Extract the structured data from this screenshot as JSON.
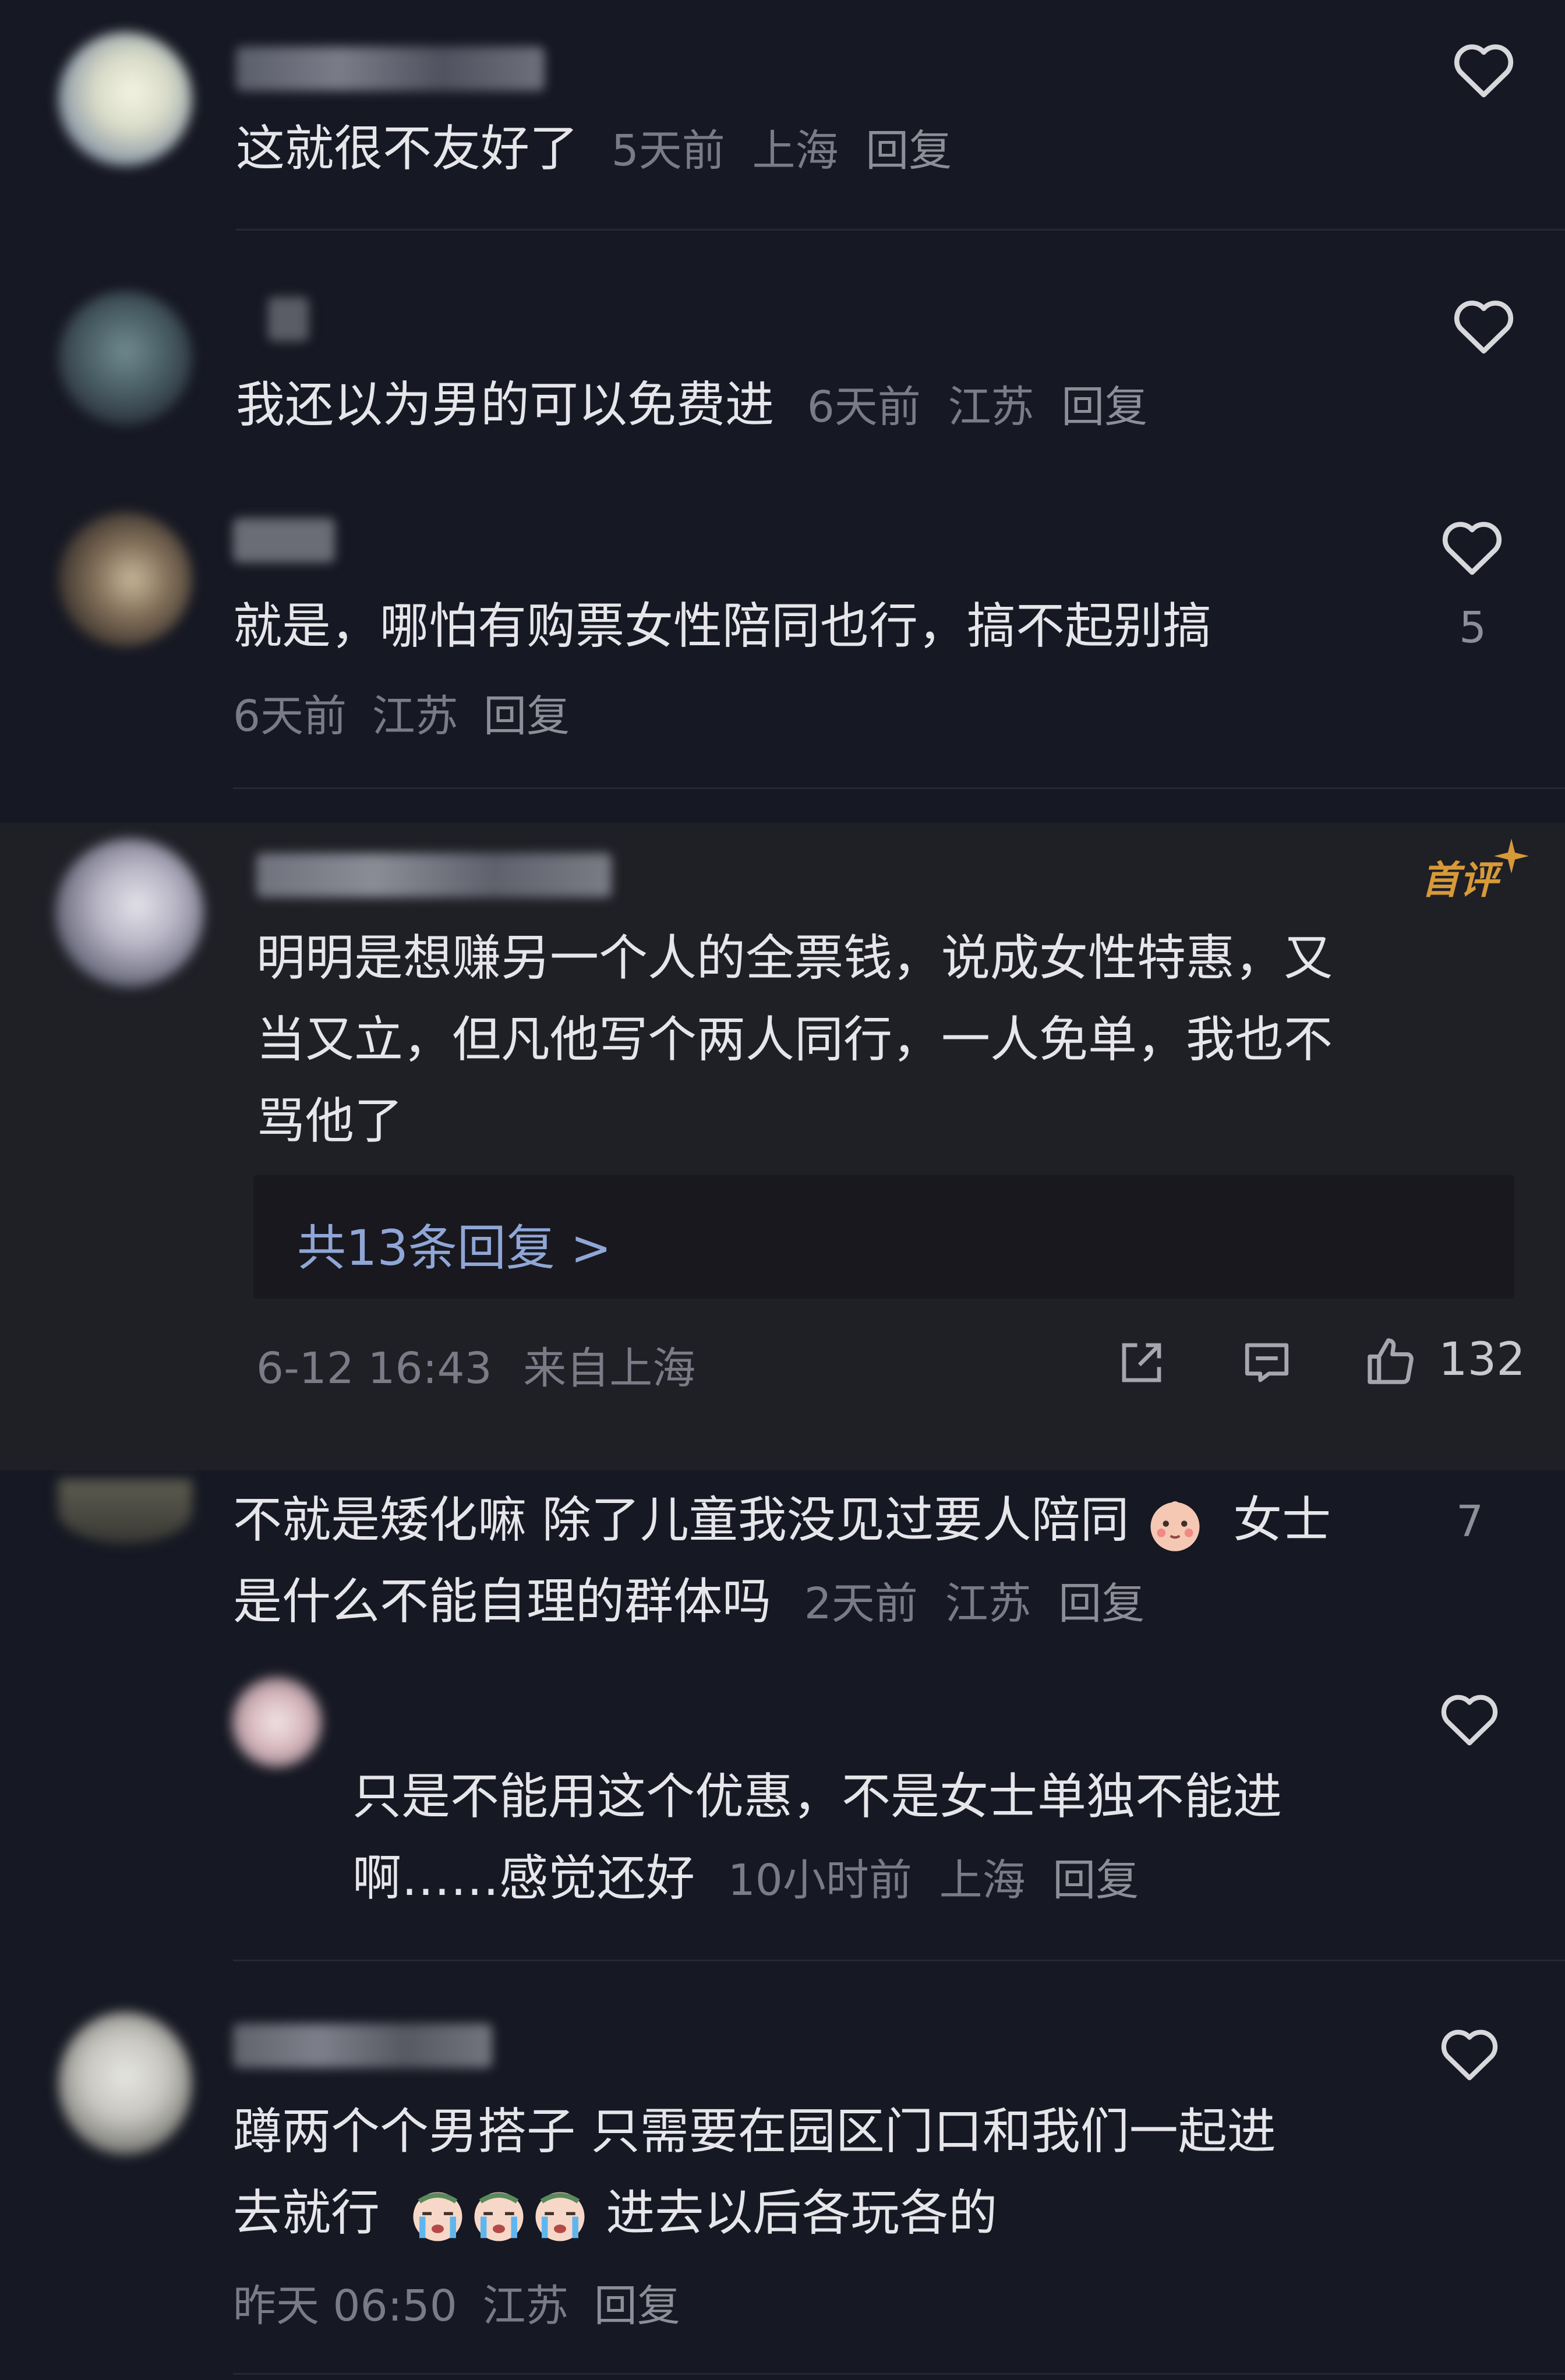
{
  "comments": [
    {
      "text": "这就很不友好了",
      "time": "5天前",
      "loc": "上海",
      "reply": "回复"
    },
    {
      "text": "我还以为男的可以免费进",
      "time": "6天前",
      "loc": "江苏",
      "reply": "回复"
    },
    {
      "text": "就是，哪怕有购票女性陪同也行，搞不起别搞",
      "time": "6天前",
      "loc": "江苏",
      "reply": "回复",
      "likes": "5"
    },
    {
      "badge": "首评",
      "lines": [
        "明明是想赚另一个人的全票钱，说成女性特惠，又",
        "当又立，但凡他写个两人同行，一人免单，我也不",
        "骂他了"
      ],
      "replies_link": "共13条回复 >",
      "datetime": "6-12 16:43",
      "from": "来自上海",
      "likes": "132"
    },
    {
      "line1": "不就是矮化嘛 除了儿童我没见过要人陪同",
      "line1b": "女士",
      "line2": "是什么不能自理的群体吗",
      "time": "2天前",
      "loc": "江苏",
      "reply": "回复",
      "likes": "7"
    },
    {
      "line1": "只是不能用这个优惠，不是女士单独不能进",
      "line2": "啊……感觉还好",
      "time": "10小时前",
      "loc": "上海",
      "reply": "回复"
    },
    {
      "line1": "蹲两个个男搭子 只需要在园区门口和我们一起进",
      "line2a": "去就行",
      "line2b": "进去以后各玩各的",
      "time": "昨天 06:50",
      "loc": "江苏",
      "reply": "回复"
    }
  ],
  "colors": {
    "background": "#161823",
    "highlight": "#1f1f26",
    "link": "#8fa6d6",
    "badge": "#d79a38"
  },
  "icons": [
    "heart-icon",
    "share-icon",
    "comment-icon",
    "thumbs-up-icon",
    "baby-emoji",
    "crying-emoji"
  ]
}
